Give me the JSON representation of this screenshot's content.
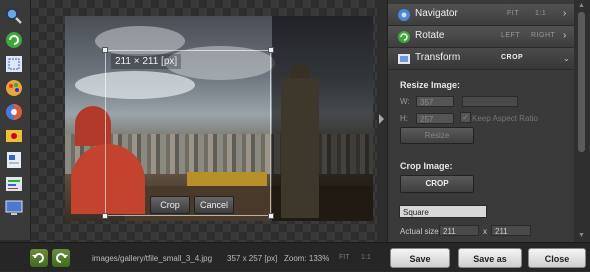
{
  "toolbar": {
    "tools": [
      {
        "icon": "zoom-icon"
      },
      {
        "icon": "rotate-icon"
      },
      {
        "icon": "crop-icon"
      },
      {
        "icon": "paint-icon"
      },
      {
        "icon": "color-wheel-icon"
      },
      {
        "icon": "image-icon"
      },
      {
        "icon": "document-icon"
      },
      {
        "icon": "adjust-icon"
      },
      {
        "icon": "display-icon"
      }
    ]
  },
  "canvas": {
    "size_badge": "211 × 211 [px]",
    "crop_button": "Crop",
    "cancel_button": "Cancel"
  },
  "panel": {
    "navigator": {
      "title": "Navigator",
      "opt1": "FIT",
      "opt2": "1:1"
    },
    "rotate": {
      "title": "Rotate",
      "opt1": "LEFT",
      "opt2": "RIGHT"
    },
    "transform": {
      "title": "Transform",
      "opt1": "CROP"
    },
    "resize": {
      "heading": "Resize Image:",
      "w_label": "W:",
      "h_label": "H:",
      "w_value": "357",
      "h_value": "257",
      "keep_ratio": "Keep Aspect Ratio",
      "resize_button": "Resize"
    },
    "crop": {
      "heading": "Crop Image:",
      "crop_button": "CROP",
      "shape": "Square",
      "actual_size_label": "Actual size:",
      "w": "211",
      "x": "x",
      "h": "211"
    }
  },
  "status": {
    "path": "images/gallery/tfile_small_3_4.jpg",
    "dims": "357 x 257 [px]",
    "zoom": "Zoom: 133%",
    "fit": "FIT",
    "one_to_one": "1:1",
    "save": "Save",
    "save_as": "Save as",
    "close": "Close"
  },
  "colors": {
    "accent_green": "#5a8a2a",
    "panel_bg": "#3a3a3a"
  }
}
